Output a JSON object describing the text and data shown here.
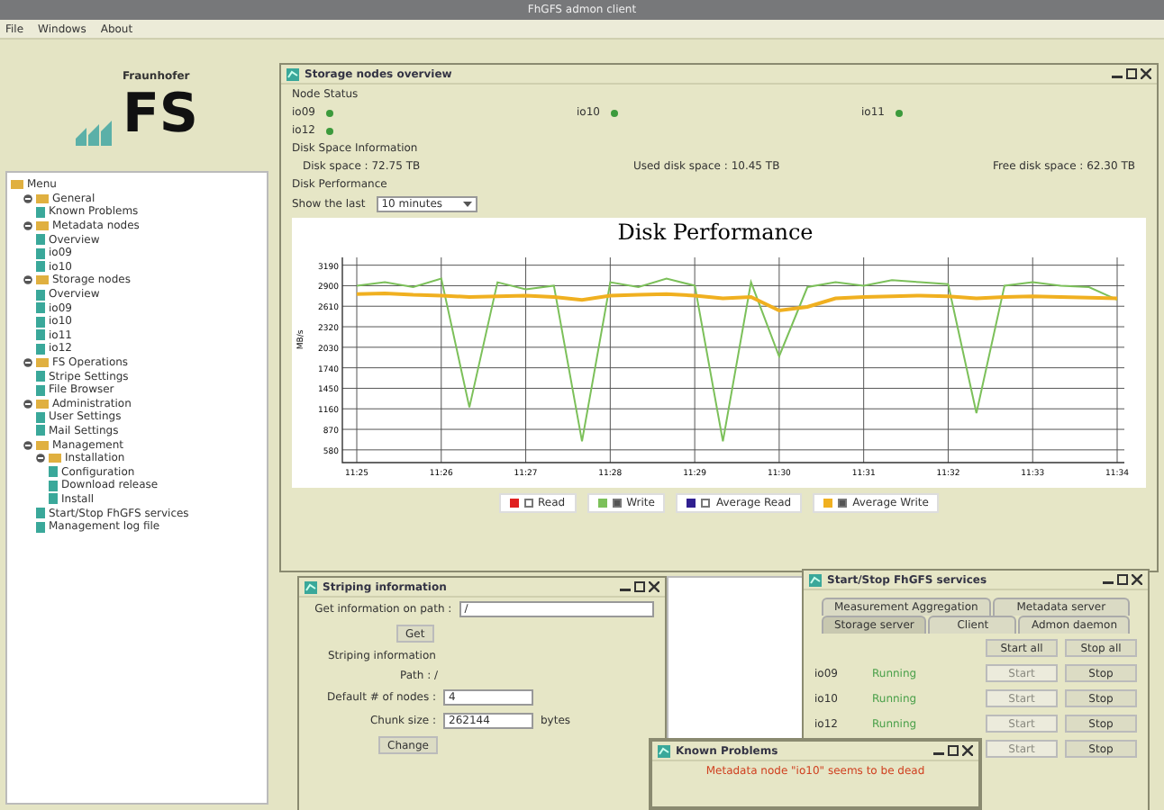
{
  "window": {
    "title": "FhGFS admon client"
  },
  "menu": [
    "File",
    "Windows",
    "About"
  ],
  "logo": {
    "org": "Fraunhofer",
    "mark": "FS"
  },
  "tree": {
    "label": "Menu",
    "children": [
      {
        "label": "General",
        "expanded": true,
        "children": [
          {
            "label": "Known Problems"
          }
        ]
      },
      {
        "label": "Metadata nodes",
        "expanded": true,
        "children": [
          {
            "label": "Overview"
          },
          {
            "label": "io09"
          },
          {
            "label": "io10"
          }
        ]
      },
      {
        "label": "Storage nodes",
        "expanded": true,
        "children": [
          {
            "label": "Overview"
          },
          {
            "label": "io09"
          },
          {
            "label": "io10"
          },
          {
            "label": "io11"
          },
          {
            "label": "io12"
          }
        ]
      },
      {
        "label": "FS Operations",
        "expanded": true,
        "children": [
          {
            "label": "Stripe Settings"
          },
          {
            "label": "File Browser"
          }
        ]
      },
      {
        "label": "Administration",
        "expanded": true,
        "children": [
          {
            "label": "User Settings"
          },
          {
            "label": "Mail Settings"
          }
        ]
      },
      {
        "label": "Management",
        "expanded": true,
        "children": [
          {
            "label": "Installation",
            "expanded": true,
            "children": [
              {
                "label": "Configuration"
              },
              {
                "label": "Download release"
              },
              {
                "label": "Install"
              }
            ]
          },
          {
            "label": "Start/Stop FhGFS services"
          },
          {
            "label": "Management log file"
          }
        ]
      }
    ]
  },
  "overview": {
    "title": "Storage nodes overview",
    "node_status_label": "Node Status",
    "nodes": [
      {
        "name": "io09",
        "color": "#3c9a3c"
      },
      {
        "name": "io10",
        "color": "#3c9a3c"
      },
      {
        "name": "io11",
        "color": "#3c9a3c"
      },
      {
        "name": "io12",
        "color": "#3c9a3c"
      }
    ],
    "disk_label": "Disk Space Information",
    "disk": [
      "Disk space : 72.75 TB",
      "Used disk space : 10.45 TB",
      "Free disk space : 62.30 TB"
    ],
    "perf_label": "Disk Performance",
    "show_label": "Show the last",
    "range": "10 minutes",
    "chart_data": {
      "type": "line",
      "title": "Disk Performance",
      "ylabel": "MB/s",
      "categories": [
        "11:25",
        null,
        null,
        "11:26",
        null,
        null,
        "11:27",
        null,
        null,
        "11:28",
        null,
        null,
        "11:29",
        null,
        null,
        "11:30",
        null,
        null,
        "11:31",
        null,
        null,
        "11:32",
        null,
        null,
        "11:33",
        null,
        null,
        "11:34"
      ],
      "series": [
        {
          "name": "Read",
          "color": "#e02020",
          "values": [
            null,
            null,
            null,
            null,
            null,
            null,
            null,
            null,
            null,
            null,
            null,
            null,
            null,
            null,
            null,
            null,
            null,
            null,
            null,
            null,
            null,
            null,
            null,
            null,
            null,
            null,
            null,
            null
          ]
        },
        {
          "name": "Write",
          "color": "#7cc05a",
          "values": [
            2900,
            2950,
            2880,
            3000,
            1180,
            2950,
            2850,
            2900,
            700,
            2950,
            2880,
            3000,
            2900,
            700,
            2950,
            1900,
            2880,
            2950,
            2900,
            2980,
            2950,
            2920,
            1100,
            2900,
            2950,
            2900,
            2880,
            2700
          ]
        },
        {
          "name": "Average Read",
          "color": "#302090",
          "values": [
            null,
            null,
            null,
            null,
            null,
            null,
            null,
            null,
            null,
            null,
            null,
            null,
            null,
            null,
            null,
            null,
            null,
            null,
            null,
            null,
            null,
            null,
            null,
            null,
            null,
            null,
            null,
            null
          ]
        },
        {
          "name": "Average Write",
          "color": "#f0b020",
          "values": [
            2780,
            2790,
            2770,
            2760,
            2740,
            2750,
            2760,
            2740,
            2700,
            2760,
            2770,
            2780,
            2760,
            2720,
            2740,
            2550,
            2600,
            2720,
            2740,
            2750,
            2760,
            2750,
            2720,
            2740,
            2750,
            2740,
            2730,
            2720
          ]
        }
      ],
      "ylim": [
        400,
        3300
      ],
      "grid": true,
      "yticks": [
        580,
        870,
        1160,
        1450,
        1740,
        2030,
        2320,
        2610,
        2900,
        3190
      ]
    },
    "legend_checkboxes": [
      {
        "checked": false
      },
      {
        "checked": true
      },
      {
        "checked": false
      },
      {
        "checked": true
      }
    ]
  },
  "striping": {
    "title": "Striping information",
    "path_label": "Get information on path :",
    "path_value": "/",
    "get": "Get",
    "info_label": "Striping information",
    "path_info": "Path : /",
    "nodes_label": "Default # of nodes :",
    "nodes_value": "4",
    "chunk_label": "Chunk size :",
    "chunk_value": "262144",
    "chunk_unit": "bytes",
    "change": "Change"
  },
  "services": {
    "title": "Start/Stop FhGFS services",
    "tab_rows": [
      [
        {
          "label": "Measurement Aggregation",
          "selected": false
        },
        {
          "label": "Metadata server",
          "selected": false
        }
      ],
      [
        {
          "label": "Storage server",
          "selected": true
        },
        {
          "label": "Client",
          "selected": false
        },
        {
          "label": "Admon daemon",
          "selected": false
        }
      ]
    ],
    "start_all": "Start all",
    "stop_all": "Stop all",
    "rows": [
      {
        "name": "io09",
        "status": "Running",
        "start": "Start",
        "start_disabled": true,
        "stop": "Stop"
      },
      {
        "name": "io10",
        "status": "Running",
        "start": "Start",
        "start_disabled": true,
        "stop": "Stop"
      },
      {
        "name": "io12",
        "status": "Running",
        "start": "Start",
        "start_disabled": true,
        "stop": "Stop"
      },
      {
        "start": "Start",
        "start_disabled": true,
        "stop": "Stop"
      }
    ]
  },
  "problems": {
    "title": "Known Problems",
    "message": "Metadata node \"io10\" seems to be dead"
  }
}
